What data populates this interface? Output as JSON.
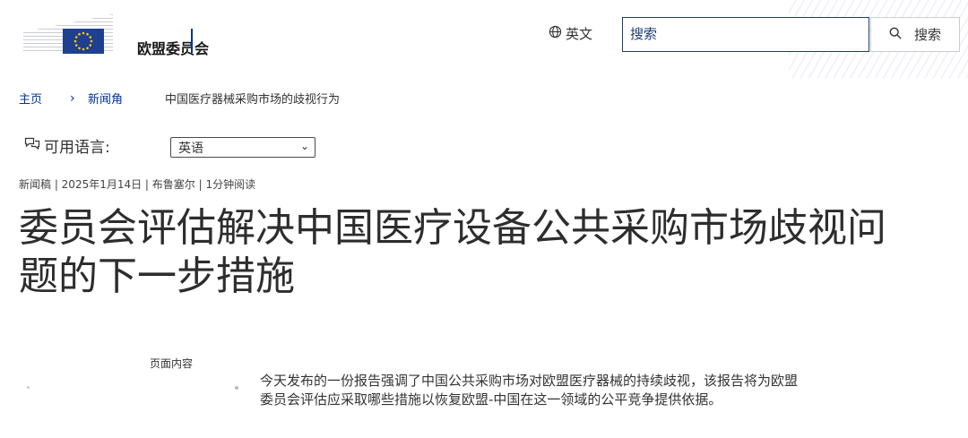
{
  "header": {
    "org_name": "欧盟委员会",
    "language_switch": "英文",
    "search": {
      "placeholder": "搜索",
      "button_label": "搜索"
    }
  },
  "breadcrumb": {
    "home": "主页",
    "newsroom": "新闻角",
    "current": "中国医疗器械采购市场的歧视行为"
  },
  "language_selector": {
    "label": "可用语言:",
    "selected": "英语"
  },
  "article": {
    "meta": "新闻稿 | 2025年1月14日 | 布鲁塞尔 | 1分钟阅读",
    "title": "委员会评估解决中国医疗设备公共采购市场歧视问题的下一步措施",
    "toc_label": "页面内容",
    "summary": "今天发布的一份报告强调了中国公共采购市场对欧盟医疗器械的持续歧视，该报告将为欧盟委员会评估应采取哪些措施以恢复欧盟-中国在这一领域的公平竞争提供依据。"
  },
  "colors": {
    "brand_blue": "#003399",
    "flag_blue": "#1f3f8f",
    "flag_stars": "#ffcc00"
  },
  "icons": [
    "globe-icon",
    "search-icon",
    "chevron-right-icon",
    "chat-bubbles-icon",
    "chevron-down-icon"
  ]
}
